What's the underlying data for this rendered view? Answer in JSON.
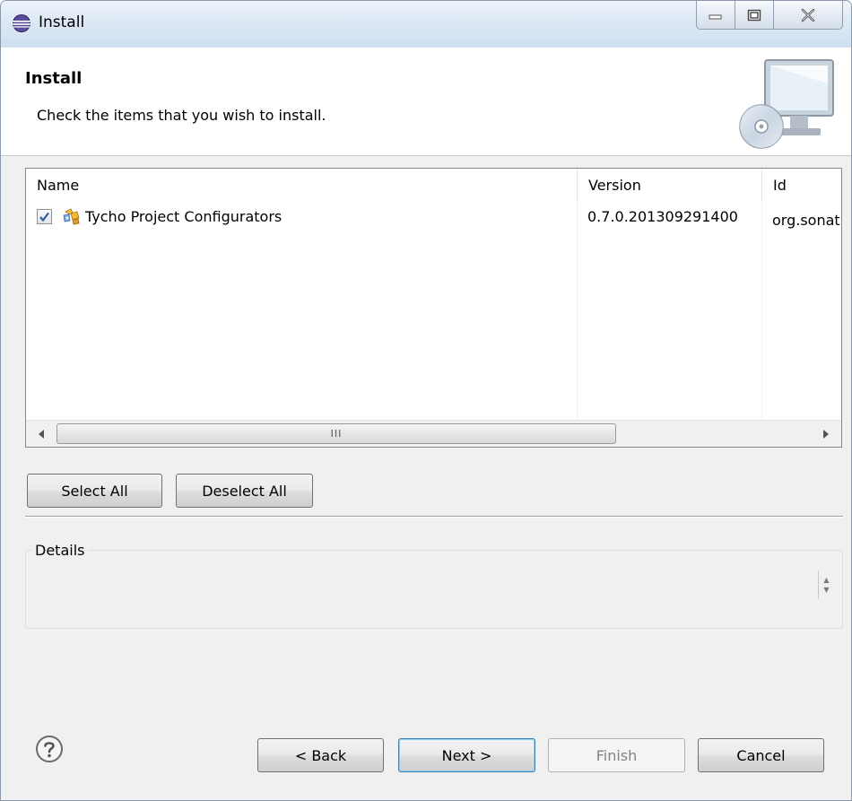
{
  "window": {
    "title": "Install",
    "app_icon": "eclipse-icon",
    "controls": [
      "minimize-icon",
      "maximize-icon",
      "close-icon"
    ]
  },
  "banner": {
    "title": "Install",
    "description": "Check the items that you wish to install.",
    "icon": "computer-cd-icon"
  },
  "table": {
    "columns": [
      "Name",
      "Version",
      "Id"
    ],
    "rows": [
      {
        "checked": true,
        "icon": "feature-plugin-icon",
        "name": "Tycho Project Configurators",
        "version": "0.7.0.201309291400",
        "id": "org.sonat"
      }
    ],
    "scroll_grip": "III"
  },
  "selection_buttons": {
    "select_all": "Select All",
    "deselect_all": "Deselect All"
  },
  "details": {
    "label": "Details",
    "content": ""
  },
  "footer": {
    "help_icon": "help-icon",
    "back": "< Back",
    "next": "Next >",
    "finish": "Finish",
    "cancel": "Cancel"
  },
  "colors": {
    "titlebar": "#dce8f5",
    "dialog_bg": "#f0f0f0",
    "default_button_border": "#3c7fb1",
    "checkmark": "#2a5fa8"
  }
}
